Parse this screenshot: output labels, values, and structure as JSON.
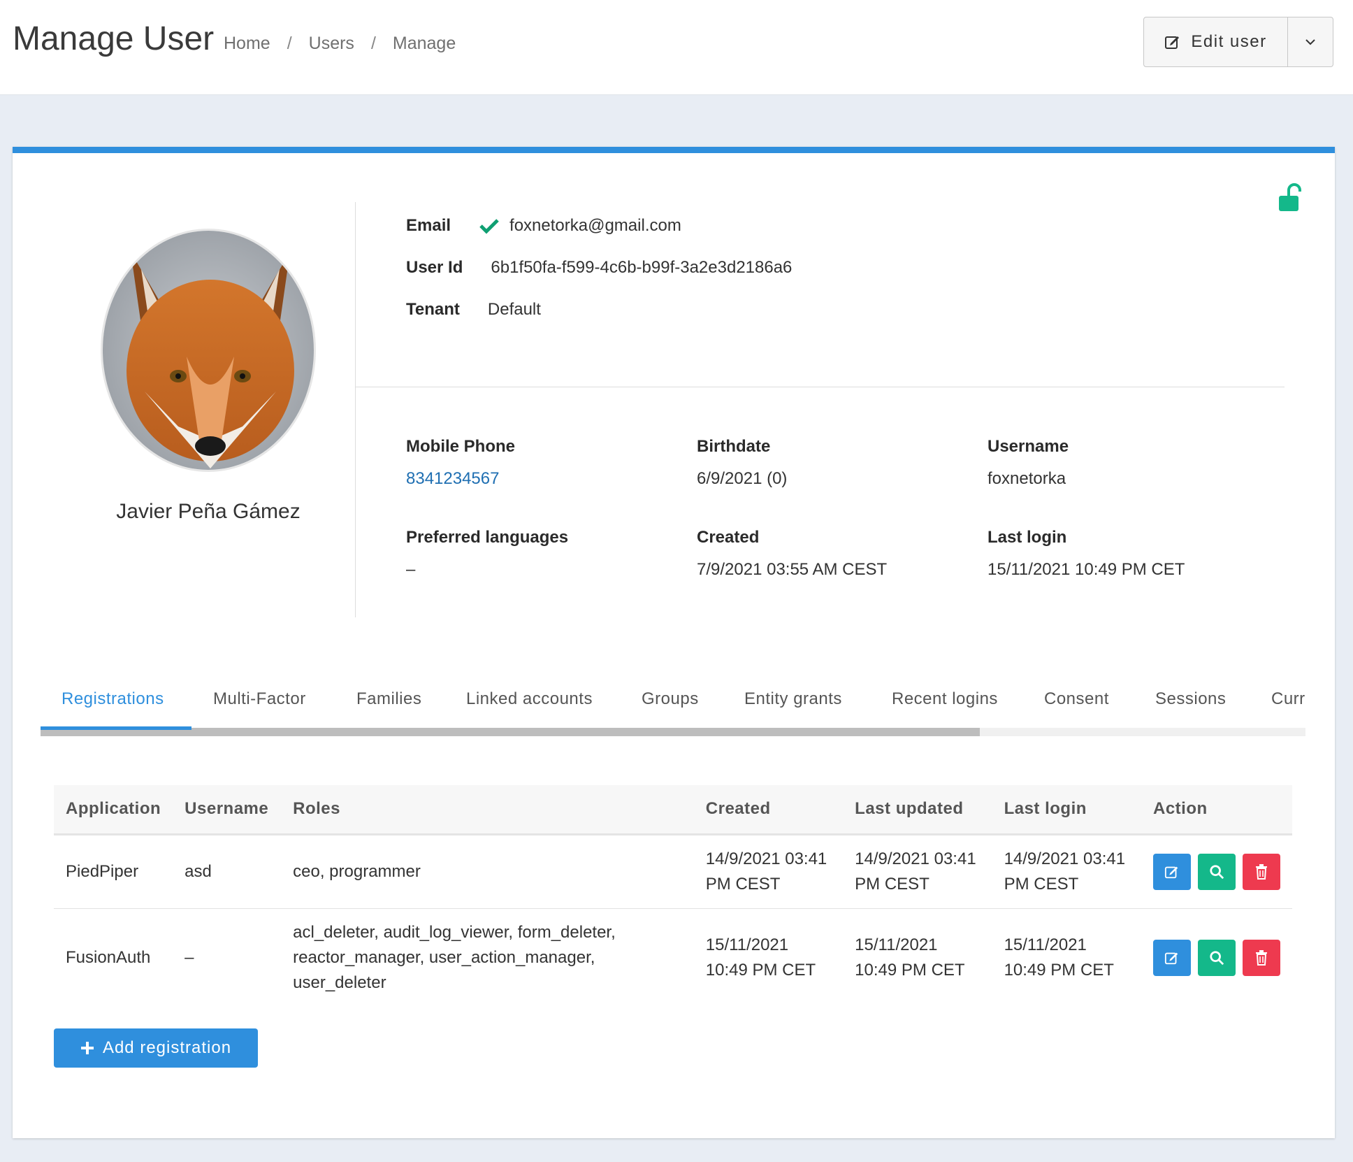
{
  "header": {
    "title": "Manage User",
    "breadcrumb": [
      "Home",
      "Users",
      "Manage"
    ],
    "breadcrumb_sep": "/",
    "edit_label": "Edit user"
  },
  "profile": {
    "name": "Javier Peña Gámez",
    "avatar_alt": "fox",
    "email_label": "Email",
    "email": "foxnetorka@gmail.com",
    "email_verified": true,
    "user_id_label": "User Id",
    "user_id": "6b1f50fa-f599-4c6b-b99f-3a2e3d2186a6",
    "tenant_label": "Tenant",
    "tenant": "Default",
    "locked": false
  },
  "details": {
    "mobile_label": "Mobile Phone",
    "mobile": "8341234567",
    "birthdate_label": "Birthdate",
    "birthdate": "6/9/2021 (0)",
    "username_label": "Username",
    "username": "foxnetorka",
    "languages_label": "Preferred languages",
    "languages": "–",
    "created_label": "Created",
    "created": "7/9/2021 03:55 AM CEST",
    "last_login_label": "Last login",
    "last_login": "15/11/2021 10:49 PM CET"
  },
  "tabs": [
    {
      "label": "Registrations",
      "active": true
    },
    {
      "label": "Multi-Factor"
    },
    {
      "label": "Families"
    },
    {
      "label": "Linked accounts"
    },
    {
      "label": "Groups"
    },
    {
      "label": "Entity grants"
    },
    {
      "label": "Recent logins"
    },
    {
      "label": "Consent"
    },
    {
      "label": "Sessions"
    },
    {
      "label": "Curr"
    }
  ],
  "registrations": {
    "columns": [
      "Application",
      "Username",
      "Roles",
      "Created",
      "Last updated",
      "Last login",
      "Action"
    ],
    "rows": [
      {
        "application": "PiedPiper",
        "username": "asd",
        "roles": "ceo, programmer",
        "created": [
          "14/9/2021 03:41",
          "PM CEST"
        ],
        "updated": [
          "14/9/2021 03:41",
          "PM CEST"
        ],
        "last_login": [
          "14/9/2021 03:41",
          "PM CEST"
        ]
      },
      {
        "application": "FusionAuth",
        "username": "–",
        "roles": [
          "acl_deleter, audit_log_viewer, form_deleter,",
          "reactor_manager, user_action_manager,",
          "user_deleter"
        ],
        "created": [
          "15/11/2021",
          "10:49 PM CET"
        ],
        "updated": [
          "15/11/2021",
          "10:49 PM CET"
        ],
        "last_login": [
          "15/11/2021",
          "10:49 PM CET"
        ]
      }
    ],
    "add_label": "Add registration"
  },
  "colors": {
    "accent": "#2f8fdd",
    "success": "#14b88a",
    "danger": "#ee3a4f",
    "link": "#1f6fb2"
  },
  "icons": {
    "edit": "edit-icon",
    "view": "search-icon",
    "delete": "trash-icon",
    "lock": "unlock-icon",
    "verified": "check-icon",
    "caret": "chevron-down-icon",
    "add": "plus-icon"
  }
}
